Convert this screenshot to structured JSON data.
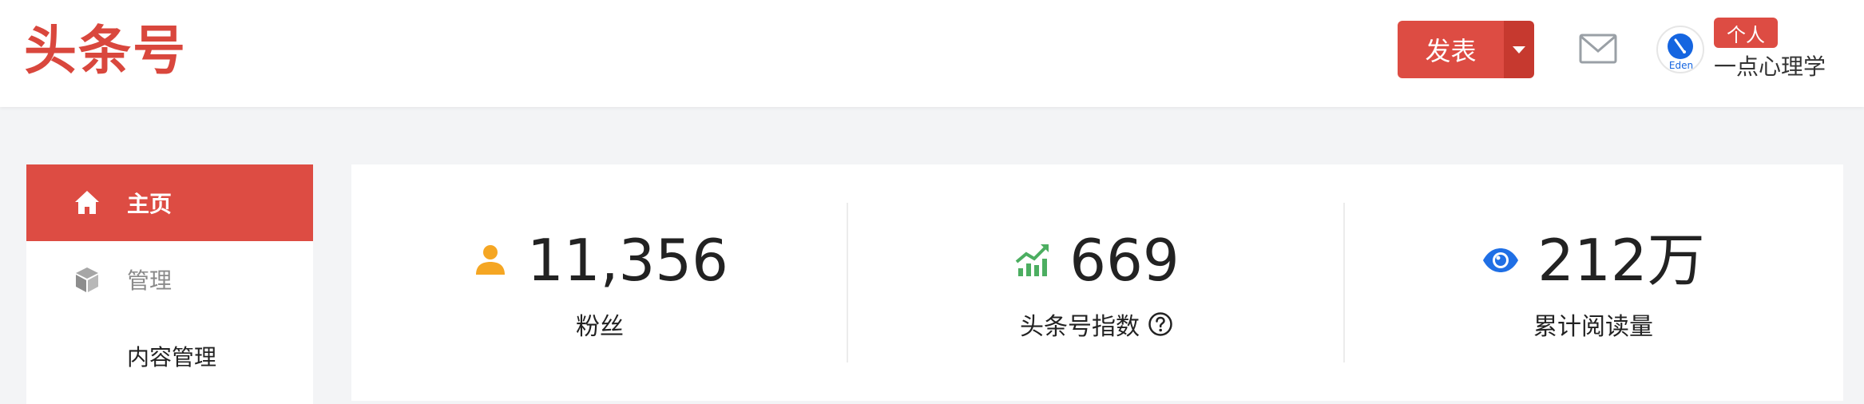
{
  "header": {
    "logo_text": "头条号",
    "publish_label": "发表",
    "badge_label": "个人",
    "username": "一点心理学",
    "avatar_text": "Eden"
  },
  "sidebar": {
    "items": [
      {
        "label": "主页",
        "icon": "home-icon",
        "state": "active"
      },
      {
        "label": "管理",
        "icon": "cube-icon",
        "state": "muted"
      },
      {
        "label": "内容管理",
        "icon": "",
        "state": "sub"
      }
    ]
  },
  "stats": [
    {
      "value": "11,356",
      "label": "粉丝",
      "icon": "person-icon",
      "color": "#f5a623"
    },
    {
      "value": "669",
      "label": "头条号指数",
      "icon": "trend-up-icon",
      "color": "#4cae61",
      "has_help": true
    },
    {
      "value": "212万",
      "label": "累计阅读量",
      "icon": "eye-icon",
      "color": "#1f6fe5"
    }
  ],
  "colors": {
    "brand": "#d9473d",
    "accent": "#dd4c43",
    "background": "#f3f4f6"
  }
}
